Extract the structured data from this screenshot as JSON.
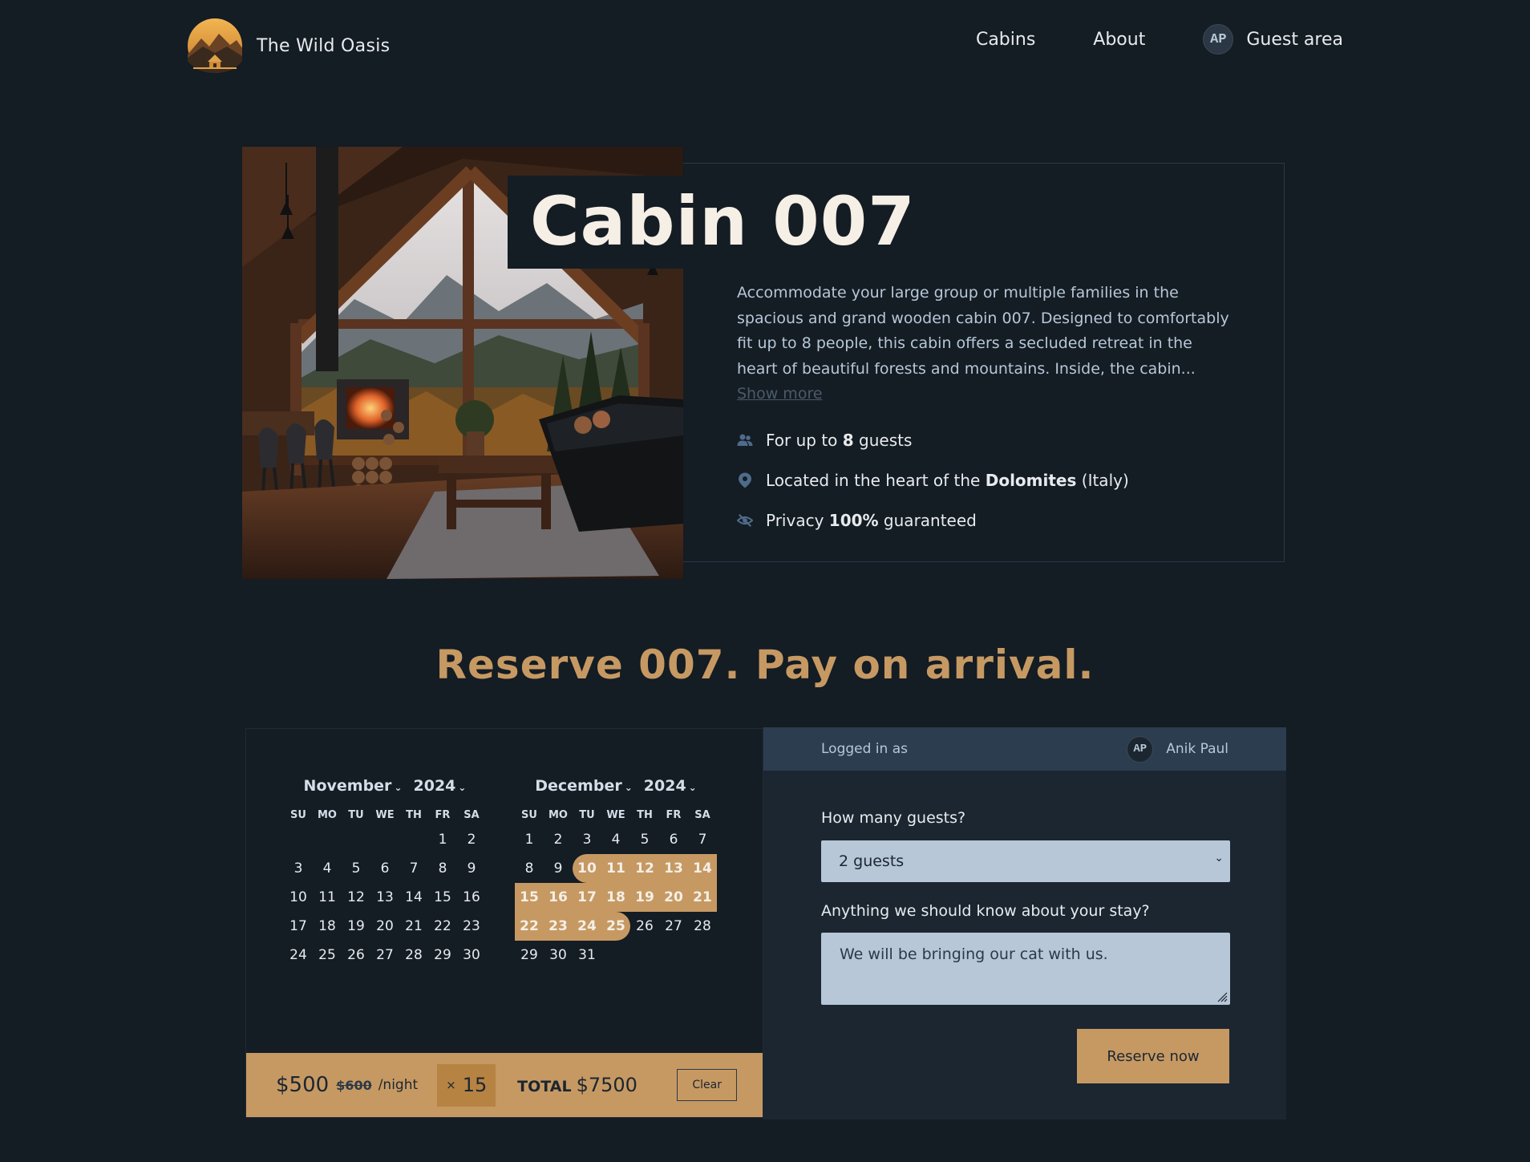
{
  "brand": {
    "name": "The Wild Oasis"
  },
  "nav": {
    "items": [
      {
        "label": "Cabins"
      },
      {
        "label": "About"
      }
    ],
    "guest_area": {
      "label": "Guest area",
      "avatar_initials": "AP"
    }
  },
  "cabin": {
    "title": "Cabin 007",
    "description": "Accommodate your large group or multiple families in the spacious and grand wooden cabin 007. Designed to comfortably fit up to 8 people, this cabin offers a secluded retreat in the heart of beautiful forests and mountains. Inside, the cabin...",
    "show_more": "Show more",
    "features": {
      "guests": {
        "icon": "users-icon",
        "prefix": "For up to ",
        "value": "8",
        "suffix": " guests"
      },
      "location": {
        "icon": "map-pin-icon",
        "prefix": "Located in the heart of the ",
        "value": "Dolomites",
        "suffix": " (Italy)"
      },
      "privacy": {
        "icon": "eye-slash-icon",
        "prefix": "Privacy ",
        "value": "100%",
        "suffix": " guaranteed"
      }
    }
  },
  "reserve": {
    "heading": "Reserve 007. Pay on arrival."
  },
  "calendar": {
    "weekdays": [
      "SU",
      "MO",
      "TU",
      "WE",
      "TH",
      "FR",
      "SA"
    ],
    "months": [
      {
        "month": "November",
        "year": "2024",
        "first_weekday": 5,
        "days": 30,
        "selected": []
      },
      {
        "month": "December",
        "year": "2024",
        "first_weekday": 0,
        "days": 31,
        "selected": [
          10,
          25
        ]
      }
    ]
  },
  "price_bar": {
    "price": "$500",
    "regular_price": "$600",
    "per_night": "/night",
    "times": "×",
    "nights": "15",
    "total_label": "TOTAL",
    "total": "$7500",
    "clear_label": "Clear"
  },
  "reservation_form": {
    "logged_in_label": "Logged in as",
    "user_name": "Anik Paul",
    "user_initials": "AP",
    "guests_label": "How many guests?",
    "guests_value": "2 guests",
    "notes_label": "Anything we should know about your stay?",
    "notes_value": "We will be bringing our cat with us.",
    "submit_label": "Reserve now"
  },
  "colors": {
    "background": "#141c24",
    "accent": "#c69963",
    "accent_dark": "#b78343",
    "panel": "#1b2631",
    "panel_header": "#2c3d4f",
    "input_bg": "#b7c7d7",
    "heading_text": "#f5efe6"
  }
}
